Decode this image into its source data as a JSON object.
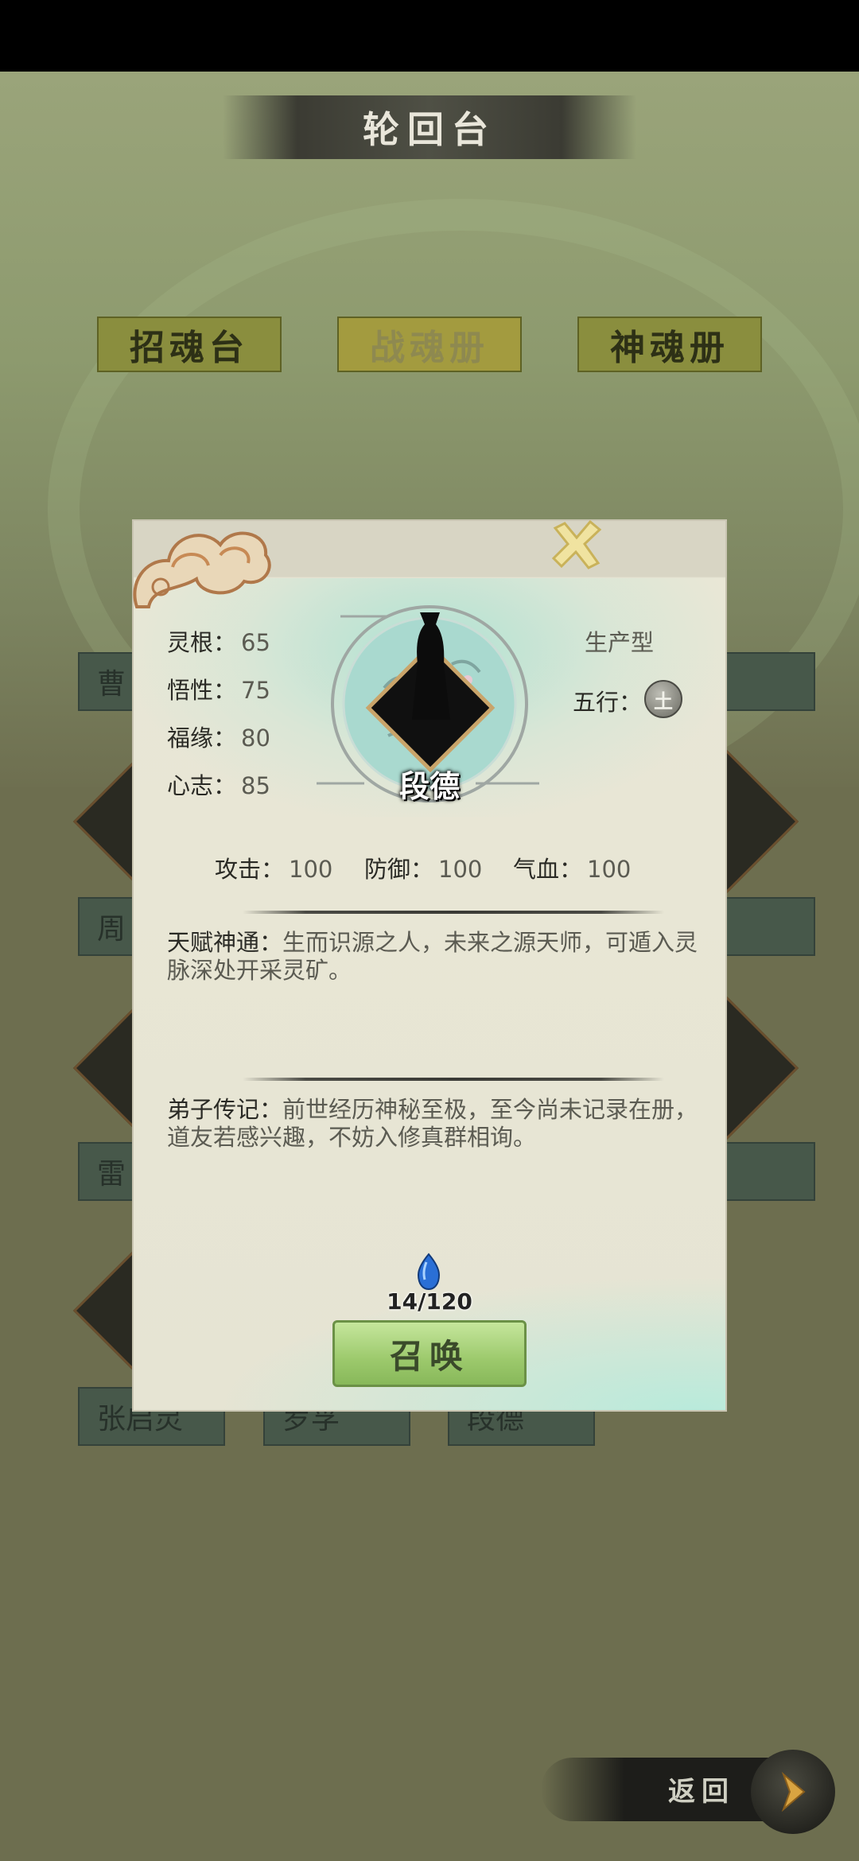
{
  "screen": {
    "title": "轮回台",
    "tabs": [
      {
        "label": "招魂台",
        "active": false
      },
      {
        "label": "战魂册",
        "active": true
      },
      {
        "label": "神魂册",
        "active": false
      }
    ],
    "background_cards": [
      "曹",
      "周",
      "雷",
      "张启灵",
      "罗孚",
      "段德"
    ],
    "back_label": "返回"
  },
  "modal": {
    "hero_name": "段德",
    "type_label": "生产型",
    "element_label": "五行",
    "element_value": "土",
    "stats_left": [
      {
        "label": "灵根",
        "value": "65"
      },
      {
        "label": "悟性",
        "value": "75"
      },
      {
        "label": "福缘",
        "value": "80"
      },
      {
        "label": "心志",
        "value": "85"
      }
    ],
    "stats_row": [
      {
        "label": "攻击",
        "value": "100"
      },
      {
        "label": "防御",
        "value": "100"
      },
      {
        "label": "气血",
        "value": "100"
      }
    ],
    "talent_key": "天赋神通：",
    "talent_text": "生而识源之人，未来之源天师，可遁入灵脉深处开采灵矿。",
    "bio_key": "弟子传记：",
    "bio_text": "前世经历神秘至极，至今尚未记录在册，道友若感兴趣，不妨入修真群相询。",
    "soul_count": "14/120",
    "summon_label": "召唤"
  },
  "colors": {
    "tab_bg": "#8a8e3e",
    "summon_green": "#9cc96c",
    "modal_bg": "#e6e4d3"
  }
}
